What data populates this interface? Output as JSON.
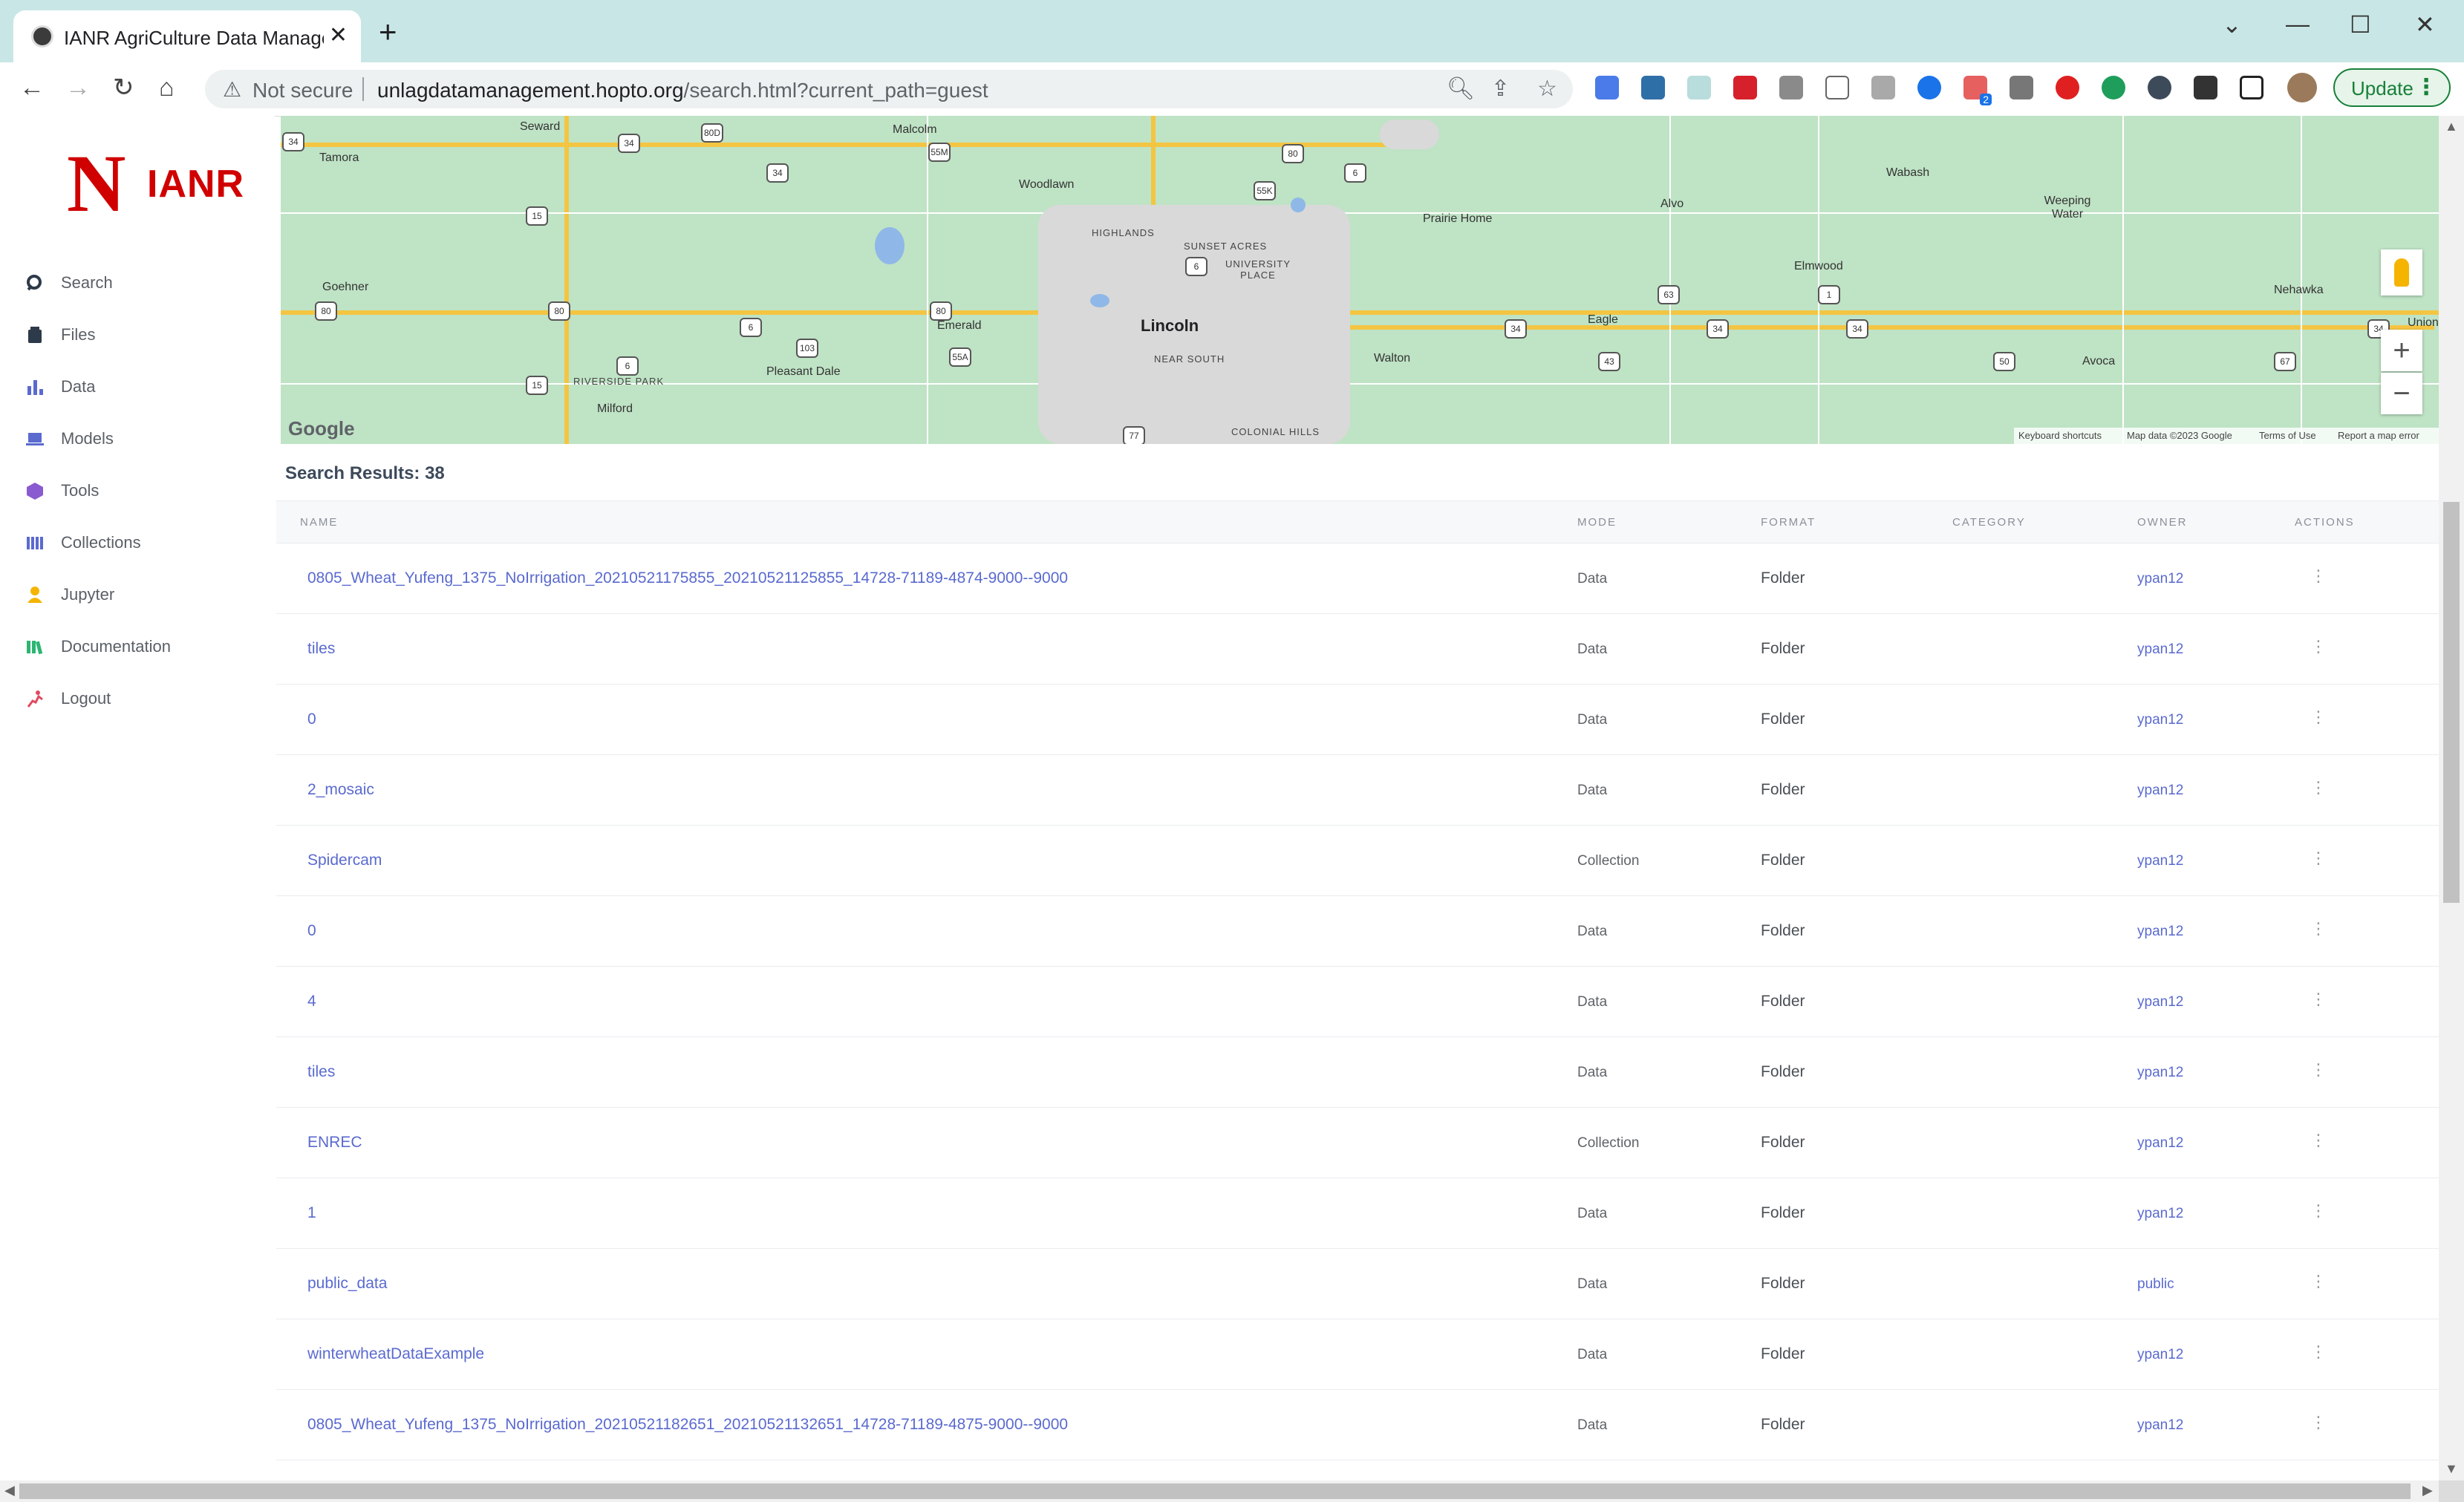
{
  "browser": {
    "tab_title": "IANR AgriCulture Data Managemen",
    "new_tab_label": "+",
    "tab_close": "✕",
    "not_secure": "Not secure",
    "url_host": "unlagdatamanagement.hopto.org",
    "url_path": "/search.html?current_path=guest",
    "update_label": "Update",
    "ext_badge": "2"
  },
  "sidebar": {
    "logo_letter": "N",
    "logo_text": "IANR",
    "items": [
      {
        "label": "Search",
        "icon": "search-icon",
        "color": "#2d3a4a"
      },
      {
        "label": "Files",
        "icon": "files-icon",
        "color": "#2d3a4a"
      },
      {
        "label": "Data",
        "icon": "data-icon",
        "color": "#5a6acf"
      },
      {
        "label": "Models",
        "icon": "models-icon",
        "color": "#5a6acf"
      },
      {
        "label": "Tools",
        "icon": "tools-icon",
        "color": "#8a5ad0"
      },
      {
        "label": "Collections",
        "icon": "collections-icon",
        "color": "#5a6acf"
      },
      {
        "label": "Jupyter",
        "icon": "jupyter-icon",
        "color": "#f4b400"
      },
      {
        "label": "Documentation",
        "icon": "documentation-icon",
        "color": "#2bb673"
      },
      {
        "label": "Logout",
        "icon": "logout-icon",
        "color": "#e04a5f"
      }
    ]
  },
  "map": {
    "places": {
      "seward": "Seward",
      "tamora": "Tamora",
      "malcolm": "Malcolm",
      "woodlawn": "Woodlawn",
      "goehner": "Goehner",
      "highlands": "HIGHLANDS",
      "sunset_acres": "SUNSET ACRES",
      "university_place": "UNIVERSITY PLACE",
      "emerald": "Emerald",
      "lincoln": "Lincoln",
      "near_south": "NEAR SOUTH",
      "walton": "Walton",
      "pleasant_dale": "Pleasant Dale",
      "riverside_park": "RIVERSIDE PARK",
      "milford": "Milford",
      "colonial_hills": "COLONIAL HILLS",
      "prairie_home": "Prairie Home",
      "alvo": "Alvo",
      "eagle": "Eagle",
      "wabash": "Wabash",
      "elmwood": "Elmwood",
      "weeping_water": "Weeping Water",
      "nehawka": "Nehawka",
      "avoca": "Avoca",
      "union": "Union"
    },
    "shields": [
      "34",
      "80D",
      "55M",
      "34",
      "80",
      "15",
      "34",
      "55K",
      "6",
      "80",
      "80",
      "6",
      "6",
      "103",
      "55A",
      "80",
      "34",
      "34",
      "63",
      "1",
      "34",
      "43",
      "50",
      "67",
      "15",
      "6",
      "77",
      "34"
    ],
    "google_logo": "Google",
    "footer": {
      "shortcuts": "Keyboard shortcuts",
      "map_data": "Map data ©2023 Google",
      "terms": "Terms of Use",
      "report": "Report a map error"
    },
    "zoom_in": "+",
    "zoom_out": "−"
  },
  "results": {
    "title": "Search Results: 38",
    "columns": {
      "name": "NAME",
      "mode": "MODE",
      "format": "FORMAT",
      "category": "CATEGORY",
      "owner": "OWNER",
      "actions": "ACTIONS"
    },
    "rows": [
      {
        "name": "0805_Wheat_Yufeng_1375_NoIrrigation_20210521175855_20210521125855_14728-71189-4874-9000--9000",
        "mode": "Data",
        "format": "Folder",
        "category": "",
        "owner": "ypan12",
        "actions": "⋮"
      },
      {
        "name": "tiles",
        "mode": "Data",
        "format": "Folder",
        "category": "",
        "owner": "ypan12",
        "actions": "⋮"
      },
      {
        "name": "0",
        "mode": "Data",
        "format": "Folder",
        "category": "",
        "owner": "ypan12",
        "actions": "⋮"
      },
      {
        "name": "2_mosaic",
        "mode": "Data",
        "format": "Folder",
        "category": "",
        "owner": "ypan12",
        "actions": "⋮"
      },
      {
        "name": "Spidercam",
        "mode": "Collection",
        "format": "Folder",
        "category": "",
        "owner": "ypan12",
        "actions": "⋮"
      },
      {
        "name": "0",
        "mode": "Data",
        "format": "Folder",
        "category": "",
        "owner": "ypan12",
        "actions": "⋮"
      },
      {
        "name": "4",
        "mode": "Data",
        "format": "Folder",
        "category": "",
        "owner": "ypan12",
        "actions": "⋮"
      },
      {
        "name": "tiles",
        "mode": "Data",
        "format": "Folder",
        "category": "",
        "owner": "ypan12",
        "actions": "⋮"
      },
      {
        "name": "ENREC",
        "mode": "Collection",
        "format": "Folder",
        "category": "",
        "owner": "ypan12",
        "actions": "⋮"
      },
      {
        "name": "1",
        "mode": "Data",
        "format": "Folder",
        "category": "",
        "owner": "ypan12",
        "actions": "⋮"
      },
      {
        "name": "public_data",
        "mode": "Data",
        "format": "Folder",
        "category": "",
        "owner": "public",
        "actions": "⋮"
      },
      {
        "name": "winterwheatDataExample",
        "mode": "Data",
        "format": "Folder",
        "category": "",
        "owner": "ypan12",
        "actions": "⋮"
      },
      {
        "name": "0805_Wheat_Yufeng_1375_NoIrrigation_20210521182651_20210521132651_14728-71189-4875-9000--9000",
        "mode": "Data",
        "format": "Folder",
        "category": "",
        "owner": "ypan12",
        "actions": "⋮"
      }
    ]
  },
  "colors": {
    "link": "#5a6acf",
    "brand_red": "#d00000",
    "tab_strip": "#c9e6e6",
    "update_green": "#188038"
  }
}
